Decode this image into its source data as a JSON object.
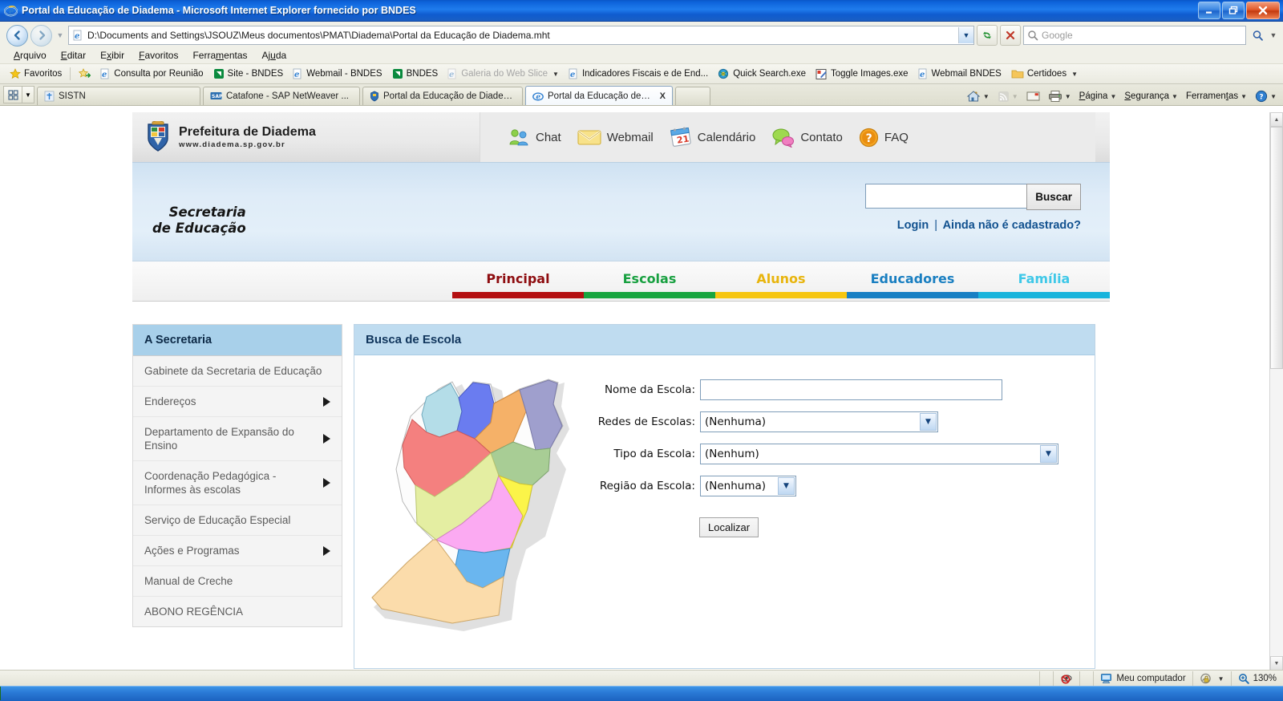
{
  "window": {
    "title": "Portal da Educação de Diadema - Microsoft Internet Explorer fornecido por BNDES",
    "minimize_label": "Minimizar",
    "maximize_label": "Restaurar",
    "close_label": "Fechar"
  },
  "address_bar": {
    "url": "D:\\Documents and Settings\\JSOUZ\\Meus documentos\\PMAT\\Diadema\\Portal da Educação de Diadema.mht",
    "search_placeholder": "Google",
    "back_label": "Voltar",
    "forward_label": "Avançar",
    "refresh_label": "Atualizar",
    "stop_label": "Parar"
  },
  "menu": {
    "items": [
      {
        "label": "Arquivo",
        "accel": "A"
      },
      {
        "label": "Editar",
        "accel": "E"
      },
      {
        "label": "Exibir",
        "accel": "x"
      },
      {
        "label": "Favoritos",
        "accel": "F"
      },
      {
        "label": "Ferramentas",
        "accel": "n"
      },
      {
        "label": "Ajuda",
        "accel": "u"
      }
    ]
  },
  "favorites_bar": {
    "root_label": "Favoritos",
    "items": [
      {
        "label": "Consulta por Reunião",
        "icon": "ie-page-icon",
        "dimmed": false
      },
      {
        "label": "Site - BNDES",
        "icon": "bndes-icon",
        "dimmed": false
      },
      {
        "label": "Webmail - BNDES",
        "icon": "ie-page-icon",
        "dimmed": false
      },
      {
        "label": "BNDES",
        "icon": "bndes-icon",
        "dimmed": false
      },
      {
        "label": "Galeria do Web Slice",
        "icon": "ie-page-icon",
        "dimmed": true,
        "caret": true
      },
      {
        "label": "Indicadores Fiscais e de End...",
        "icon": "ie-page-icon",
        "dimmed": false
      },
      {
        "label": "Quick Search.exe",
        "icon": "quicksearch-icon",
        "dimmed": false
      },
      {
        "label": "Toggle Images.exe",
        "icon": "toggle-images-icon",
        "dimmed": false
      },
      {
        "label": "Webmail BNDES",
        "icon": "ie-page-icon",
        "dimmed": false
      },
      {
        "label": "Certidoes",
        "icon": "folder-icon",
        "dimmed": false,
        "caret": true
      }
    ]
  },
  "tabs": {
    "items": [
      {
        "label": "SISTN",
        "icon": "sistn-icon",
        "active": false,
        "closable": false
      },
      {
        "label": "Catafone - SAP NetWeaver ...",
        "icon": "sap-icon",
        "active": false,
        "closable": false
      },
      {
        "label": "Portal da Educação de Diadema",
        "icon": "diadema-icon",
        "active": false,
        "closable": false
      },
      {
        "label": "Portal da Educação de Di...",
        "icon": "ie-page-icon",
        "active": true,
        "closable": true,
        "close_label": "X"
      }
    ]
  },
  "command_bar": {
    "items": [
      {
        "label": "",
        "icon": "home-icon",
        "caret": true
      },
      {
        "label": "",
        "icon": "feeds-icon",
        "caret": true,
        "dimmed": true
      },
      {
        "label": "",
        "icon": "read-mail-icon",
        "caret": false
      },
      {
        "label": "",
        "icon": "print-icon",
        "caret": true
      },
      {
        "label": "Página",
        "icon": "",
        "caret": true,
        "accel": "P"
      },
      {
        "label": "Segurança",
        "icon": "",
        "caret": true,
        "accel": "S"
      },
      {
        "label": "Ferramentas",
        "icon": "",
        "caret": true,
        "accel": "t"
      },
      {
        "label": "",
        "icon": "help-icon",
        "caret": true
      }
    ]
  },
  "site": {
    "brand": {
      "title": "Prefeitura de Diadema",
      "subtitle": "www.diadema.sp.gov.br",
      "crest_icon": "coat-of-arms-icon"
    },
    "top_nav": [
      {
        "label": "Chat",
        "icon": "chat-people-icon"
      },
      {
        "label": "Webmail",
        "icon": "envelope-icon"
      },
      {
        "label": "Calendário",
        "icon": "calendar-icon",
        "calendar_day": "21"
      },
      {
        "label": "Contato",
        "icon": "speech-bubbles-icon"
      },
      {
        "label": "FAQ",
        "icon": "question-mark-icon"
      }
    ],
    "secretaria": {
      "line1": "Secretaria",
      "line2": "de Educação"
    },
    "search": {
      "value": "",
      "placeholder": "",
      "button_label": "Buscar"
    },
    "account": {
      "login_label": "Login",
      "separator": "|",
      "register_label": "Ainda não é cadastrado?"
    },
    "nav_tabs": [
      {
        "label": "Principal",
        "color": "#8e0d10",
        "bar_color": "#b40f11",
        "active": true
      },
      {
        "label": "Escolas",
        "color": "#18a040",
        "bar_color": "#17a53f",
        "active": false
      },
      {
        "label": "Alunos",
        "color": "#e8b50e",
        "bar_color": "#f6c611",
        "active": false
      },
      {
        "label": "Educadores",
        "color": "#1a7fc1",
        "bar_color": "#1880c4",
        "active": false
      },
      {
        "label": "Família",
        "color": "#3fc8e8",
        "bar_color": "#18b4dc",
        "active": false
      }
    ],
    "sidebar": {
      "header": "A Secretaria",
      "items": [
        {
          "label": "Gabinete da Secretaria de Educação",
          "has_arrow": false
        },
        {
          "label": "Endereços",
          "has_arrow": true
        },
        {
          "label": "Departamento de Expansão do Ensino",
          "has_arrow": true
        },
        {
          "label": "Coordenação Pedagógica - Informes às escolas",
          "has_arrow": true
        },
        {
          "label": "Serviço de Educação Especial",
          "has_arrow": false
        },
        {
          "label": "Ações e Programas",
          "has_arrow": true
        },
        {
          "label": "Manual de Creche",
          "has_arrow": false
        },
        {
          "label": "ABONO REGÊNCIA",
          "has_arrow": false
        }
      ]
    },
    "panel": {
      "title": "Busca de Escola",
      "map_alt": "Mapa de regiões de Diadema",
      "map_regions": [
        {
          "name": "regiao-azul-claro",
          "color": "#b4dde8"
        },
        {
          "name": "regiao-azul",
          "color": "#6a7cf0"
        },
        {
          "name": "regiao-laranja",
          "color": "#f5b168"
        },
        {
          "name": "regiao-roxo",
          "color": "#9f9fcd"
        },
        {
          "name": "regiao-vermelho",
          "color": "#f4807f"
        },
        {
          "name": "regiao-verde",
          "color": "#a8cd95"
        },
        {
          "name": "regiao-verde-claro",
          "color": "#e4eea2"
        },
        {
          "name": "regiao-rosa",
          "color": "#fbaaf2"
        },
        {
          "name": "regiao-amarelo",
          "color": "#fbf449"
        },
        {
          "name": "regiao-azul-medio",
          "color": "#6ab6ef"
        },
        {
          "name": "regiao-bege",
          "color": "#fbdcab"
        }
      ],
      "fields": [
        {
          "id": "nome-da-escola",
          "label": "Nome da Escola:",
          "type": "text",
          "value": ""
        },
        {
          "id": "redes-de-escolas",
          "label": "Redes de Escolas:",
          "type": "select",
          "value": "(Nenhuma)"
        },
        {
          "id": "tipo-da-escola",
          "label": "Tipo da Escola:",
          "type": "select",
          "value": "(Nenhum)"
        },
        {
          "id": "regiao-da-escola",
          "label": "Região da Escola:",
          "type": "select",
          "value": "(Nenhuma)"
        }
      ],
      "submit_label": "Localizar"
    }
  },
  "status_bar": {
    "message": "",
    "blocked_label": "Pop-ups bloqueados",
    "zone_label": "Meu computador",
    "zone_icon": "computer-icon",
    "protected_label": "Modo Protegido",
    "zoom_label": "130%",
    "zoom_icon": "magnifier-plus-icon"
  }
}
